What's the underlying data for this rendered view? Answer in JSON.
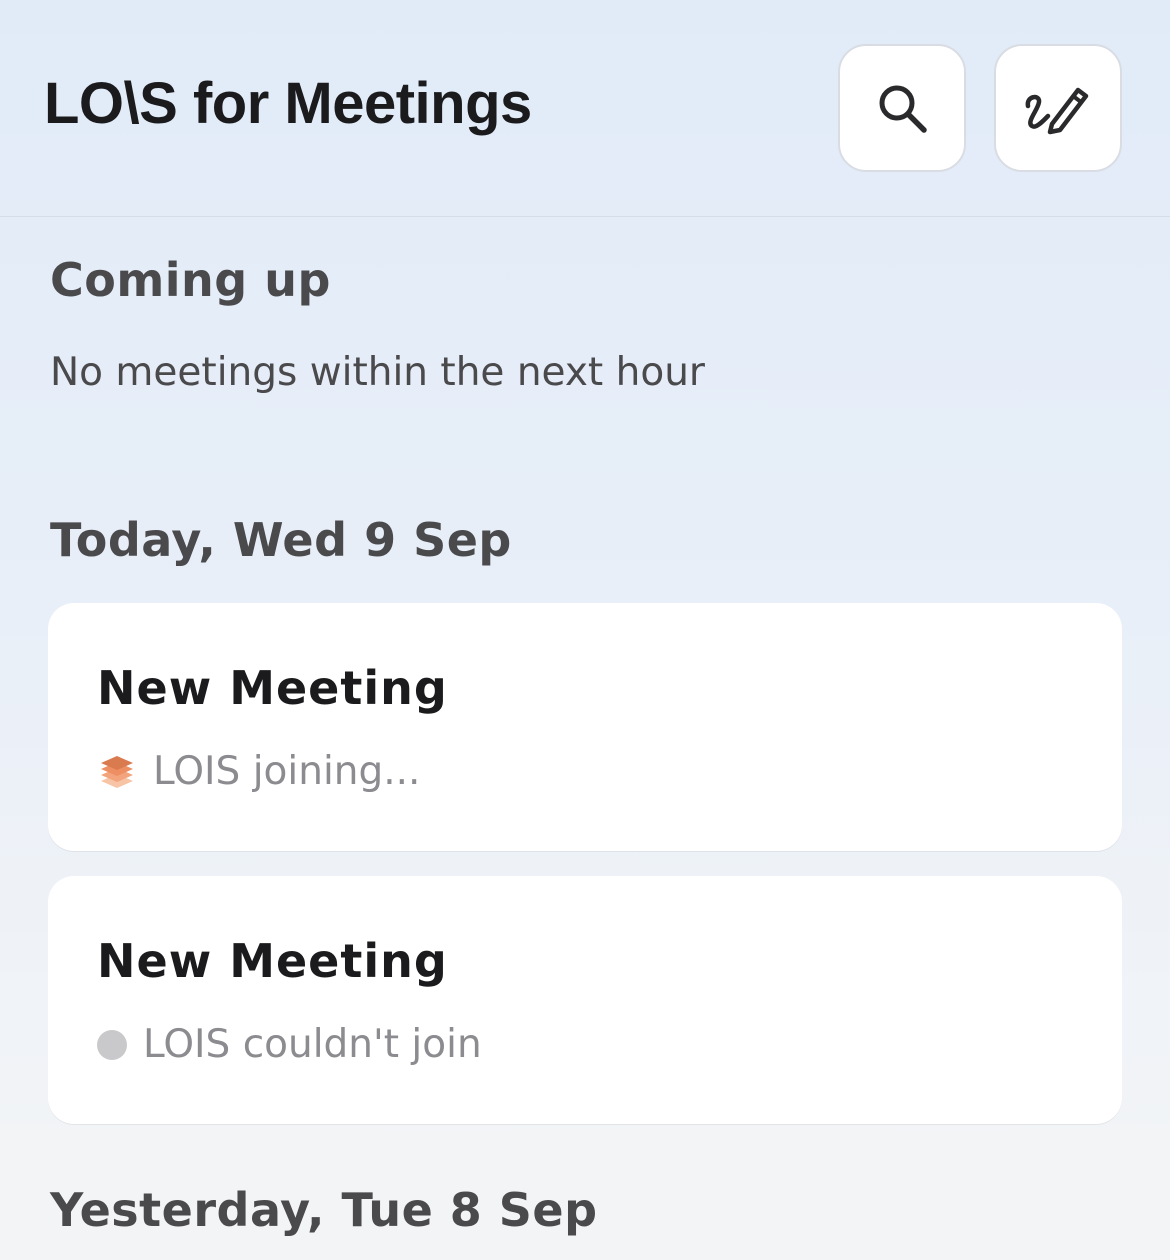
{
  "header": {
    "title": "LO\\S for Meetings",
    "search_icon": "search-icon",
    "compose_icon": "compose-pen-icon"
  },
  "coming_up": {
    "title": "Coming up",
    "empty_text": "No meetings within the next hour"
  },
  "days": [
    {
      "label": "Today, Wed 9 Sep",
      "meetings": [
        {
          "title": "New Meeting",
          "status": "LOIS joining...",
          "status_icon": "layers-icon"
        },
        {
          "title": "New Meeting",
          "status": "LOIS couldn't join",
          "status_icon": "status-dot"
        }
      ]
    },
    {
      "label": "Yesterday, Tue 8 Sep",
      "meetings": []
    }
  ],
  "colors": {
    "accent_orange": "#f29a6b",
    "status_gray": "#c9c9cc"
  }
}
